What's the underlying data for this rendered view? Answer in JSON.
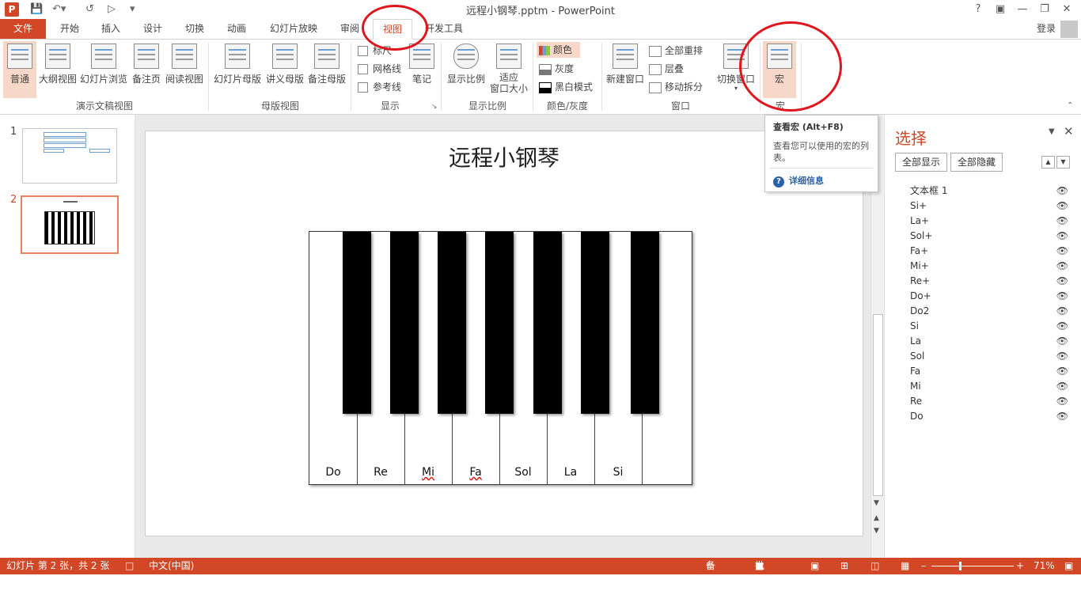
{
  "window": {
    "title": "远程小钢琴.pptm - PowerPoint",
    "help": "?",
    "controls": [
      "—",
      "❐",
      "✕"
    ]
  },
  "tabs": [
    "文件",
    "开始",
    "插入",
    "设计",
    "切换",
    "动画",
    "幻灯片放映",
    "审阅",
    "视图",
    "开发工具"
  ],
  "active_tab": "视图",
  "login": "登录",
  "ribbon": {
    "presentation_views": {
      "label": "演示文稿视图",
      "buttons": [
        "普通",
        "大纲视图",
        "幻灯片浏览",
        "备注页",
        "阅读视图"
      ]
    },
    "master_views": {
      "label": "母版视图",
      "buttons": [
        "幻灯片母版",
        "讲义母版",
        "备注母版"
      ]
    },
    "show": {
      "label": "显示",
      "checks": [
        "标尺",
        "网格线",
        "参考线"
      ],
      "notes": "笔记"
    },
    "zoom": {
      "label": "显示比例",
      "zoom": "显示比例",
      "fit_line1": "适应",
      "fit_line2": "窗口大小"
    },
    "color": {
      "label": "颜色/灰度",
      "options": [
        "颜色",
        "灰度",
        "黑白模式"
      ]
    },
    "window": {
      "label": "窗口",
      "new_window": "新建窗口",
      "arrange_all": "全部重排",
      "cascade": "层叠",
      "move_split": "移动拆分",
      "switch_windows": "切换窗口"
    },
    "macros": {
      "label": "宏",
      "button": "宏"
    }
  },
  "tooltip": {
    "title": "查看宏 (Alt+F8)",
    "body": "查看您可以使用的宏的列表。",
    "help": "详细信息"
  },
  "slides": {
    "numbers": [
      "1",
      "2"
    ],
    "selected": 2
  },
  "slide": {
    "title": "远程小钢琴",
    "white_keys": [
      "Do",
      "Re",
      "Mi",
      "Fa",
      "Sol",
      "La",
      "Si",
      ""
    ],
    "black_key_count": 7
  },
  "selection_pane": {
    "title": "选择",
    "show_all": "全部显示",
    "hide_all": "全部隐藏",
    "items": [
      "文本框 1",
      "Si+",
      "La+",
      "Sol+",
      "Fa+",
      "Mi+",
      "Re+",
      "Do+",
      "Do2",
      "Si",
      "La",
      "Sol",
      "Fa",
      "Mi",
      "Re",
      "Do"
    ]
  },
  "status": {
    "slide_info": "幻灯片 第 2 张，共 2 张",
    "language": "中文(中国)",
    "notes": "备注",
    "comments": "批注",
    "zoom": "71%"
  },
  "colors": {
    "accent": "#d24726",
    "annotation": "#e1151c"
  }
}
